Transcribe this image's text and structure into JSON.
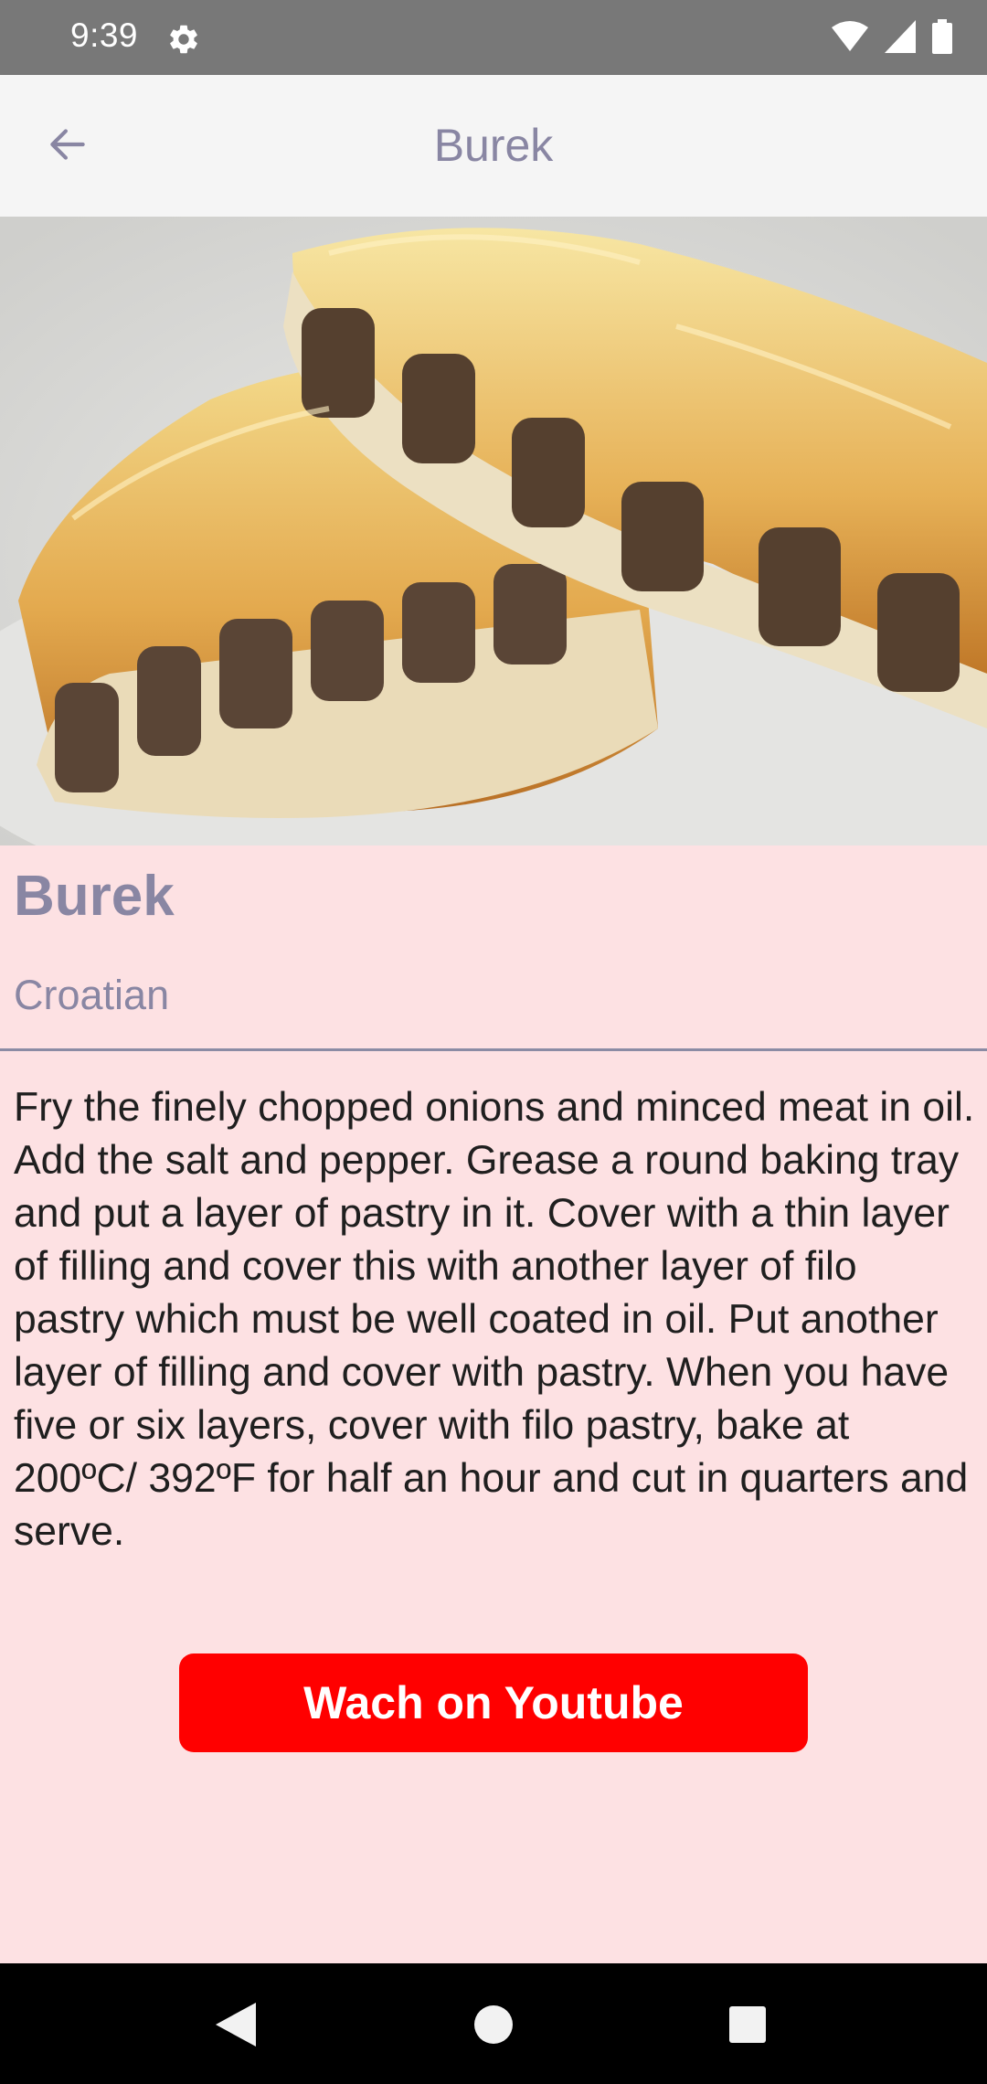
{
  "status_bar": {
    "time": "9:39",
    "icons": [
      "gear-icon",
      "wifi-icon",
      "signal-icon",
      "battery-icon"
    ]
  },
  "app_bar": {
    "title": "Burek",
    "back_icon": "arrow-back-icon"
  },
  "recipe": {
    "name": "Burek",
    "area": "Croatian",
    "instructions": "Fry the finely chopped onions and minced meat in oil. Add the salt and pepper. Grease a round baking tray and put a layer of pastry in it. Cover with a thin layer of filling and cover this with another layer of filo pastry which must be well coated in oil. Put another layer of filling and cover with pastry. When you have five or six layers, cover with filo pastry, bake at 200ºC/ 392ºF for half an hour and cut in quarters and serve.",
    "youtube_button_label": "Wach on Youtube"
  },
  "nav_bar": {
    "icons": [
      "nav-back-icon",
      "nav-home-icon",
      "nav-recents-icon"
    ]
  },
  "colors": {
    "page_background": "#fde1e3",
    "accent_text": "#8986a3",
    "youtube_red": "#ff0000",
    "status_bar": "#787878",
    "app_bar": "#f5f5f5"
  }
}
